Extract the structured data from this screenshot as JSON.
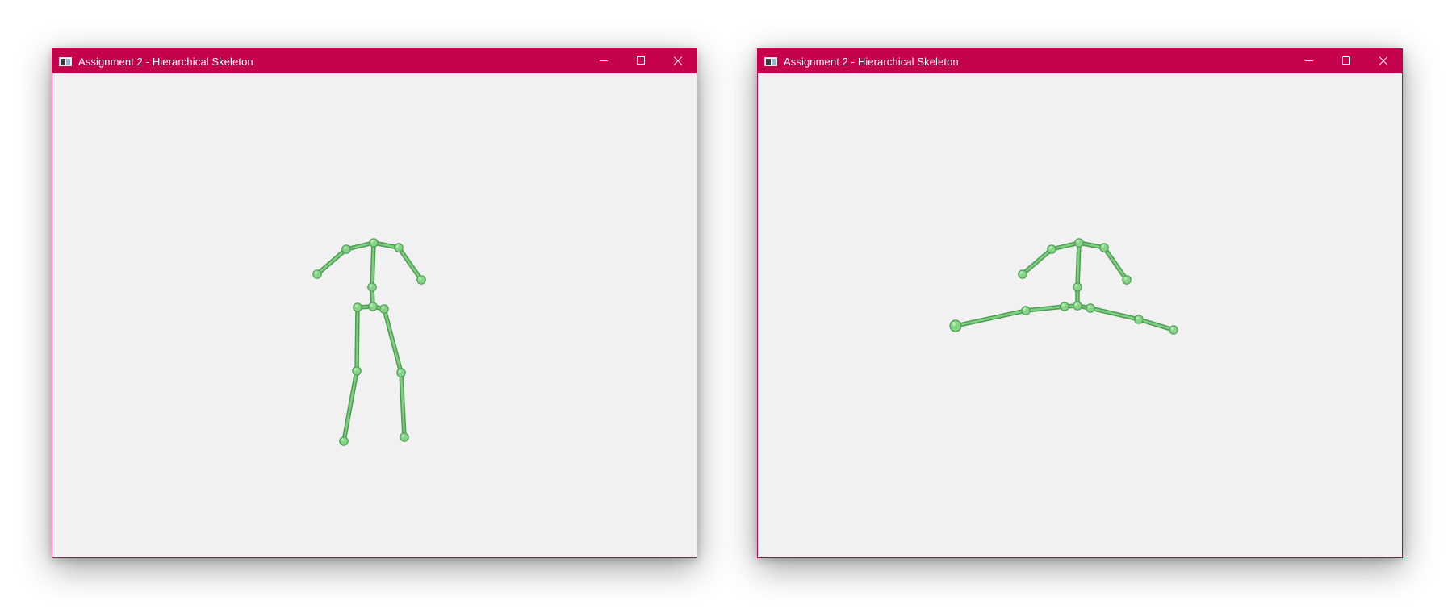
{
  "windows": [
    {
      "id": "win-1",
      "title": "Assignment 2 - Hierarchical Skeleton",
      "pose": "standing",
      "bones": [
        [
          "neck",
          "l_shoulder"
        ],
        [
          "l_shoulder",
          "l_hand"
        ],
        [
          "neck",
          "r_shoulder"
        ],
        [
          "r_shoulder",
          "r_hand"
        ],
        [
          "neck",
          "spine"
        ],
        [
          "spine",
          "pelvis"
        ],
        [
          "pelvis",
          "l_hip"
        ],
        [
          "l_hip",
          "l_knee"
        ],
        [
          "l_knee",
          "l_foot"
        ],
        [
          "pelvis",
          "r_hip"
        ],
        [
          "r_hip",
          "r_knee"
        ],
        [
          "r_knee",
          "r_foot"
        ]
      ]
    },
    {
      "id": "win-2",
      "title": "Assignment 2 - Hierarchical Skeleton",
      "pose": "legs-spread",
      "bones": [
        [
          "neck",
          "l_shoulder"
        ],
        [
          "l_shoulder",
          "l_hand"
        ],
        [
          "neck",
          "r_shoulder"
        ],
        [
          "r_shoulder",
          "r_hand"
        ],
        [
          "neck",
          "spine"
        ],
        [
          "spine",
          "pelvis"
        ],
        [
          "pelvis",
          "l_hip"
        ],
        [
          "l_hip",
          "l_knee"
        ],
        [
          "l_knee",
          "l_foot"
        ],
        [
          "pelvis",
          "r_hip"
        ],
        [
          "r_hip",
          "r_knee"
        ],
        [
          "r_knee",
          "r_foot"
        ]
      ]
    }
  ],
  "colors": {
    "titlebar": "#c5004c",
    "title_text": "#ffffff",
    "viewport_bg": "#f1f1f1",
    "bone": "#7ccf7c",
    "bone_edge": "#4e9a55",
    "joint": "#86d586",
    "joint_edge": "#4f9d56"
  },
  "icons": {
    "app": "app-icon",
    "minimize": "minimize-icon",
    "maximize": "maximize-icon",
    "close": "close-icon"
  }
}
